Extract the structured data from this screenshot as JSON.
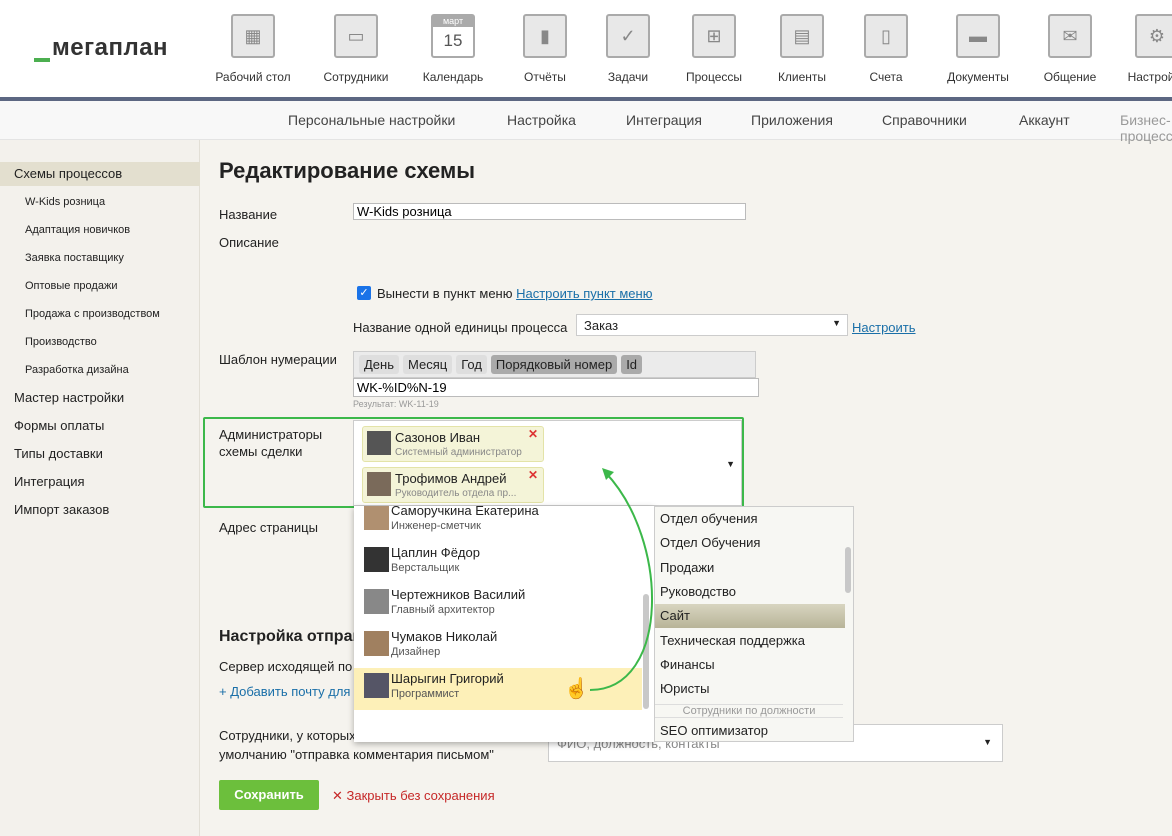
{
  "logo": "мегаплан",
  "nav": [
    {
      "label": "Рабочий стол",
      "icon": "dashboard-icon"
    },
    {
      "label": "Сотрудники",
      "icon": "employees-icon"
    },
    {
      "label": "Календарь",
      "icon": "calendar-icon",
      "badge_month": "март",
      "badge_day": "15"
    },
    {
      "label": "Отчёты",
      "icon": "reports-icon"
    },
    {
      "label": "Задачи",
      "icon": "tasks-icon"
    },
    {
      "label": "Процессы",
      "icon": "processes-icon"
    },
    {
      "label": "Клиенты",
      "icon": "clients-icon"
    },
    {
      "label": "Счета",
      "icon": "invoices-icon"
    },
    {
      "label": "Документы",
      "icon": "documents-icon"
    },
    {
      "label": "Общение",
      "icon": "chat-icon"
    },
    {
      "label": "Настройки",
      "icon": "gear-icon"
    }
  ],
  "subnav": [
    "Персональные настройки",
    "Настройка",
    "Интеграция",
    "Приложения",
    "Справочники",
    "Аккаунт",
    "Бизнес-процессы"
  ],
  "sidebar": [
    {
      "label": "Схемы процессов",
      "level": 0,
      "active": true
    },
    {
      "label": "W-Kids розница",
      "level": 1
    },
    {
      "label": "Адаптация новичков",
      "level": 1
    },
    {
      "label": "Заявка поставщику",
      "level": 1
    },
    {
      "label": "Оптовые продажи",
      "level": 1
    },
    {
      "label": "Продажа с производством",
      "level": 1
    },
    {
      "label": "Производство",
      "level": 1
    },
    {
      "label": "Разработка дизайна",
      "level": 1
    },
    {
      "label": "Мастер настройки",
      "level": 0
    },
    {
      "label": "Формы оплаты",
      "level": 0
    },
    {
      "label": "Типы доставки",
      "level": 0
    },
    {
      "label": "Интеграция",
      "level": 0
    },
    {
      "label": "Импорт заказов",
      "level": 0
    }
  ],
  "form": {
    "title": "Редактирование схемы",
    "name_label": "Название",
    "name_value": "W-Kids розница",
    "desc_label": "Описание",
    "desc_value": "",
    "menu_checkbox_label": "Вынести в пункт меню",
    "menu_checked": true,
    "menu_link": "Настроить пункт меню",
    "unit_label": "Название одной единицы процесса",
    "unit_value": "Заказ",
    "unit_link": "Настроить",
    "numbering_label": "Шаблон нумерации",
    "numbering_tokens": [
      "День",
      "Месяц",
      "Год",
      "Порядковый номер",
      "Id"
    ],
    "numbering_value": "WK-%ID%N-19",
    "numbering_result": "Результат: WK-11-19",
    "admins_label_1": "Администраторы",
    "admins_label_2": "схемы сделки",
    "admins": [
      {
        "name": "Сазонов Иван",
        "position": "Системный администратор"
      },
      {
        "name": "Трофимов Андрей",
        "position": "Руководитель отдела пр..."
      }
    ],
    "address_label": "Адрес страницы",
    "mail_section_title": "Настройка отправки",
    "mail_server_label": "Сервер исходящей по",
    "add_mail_link": "+ Добавить почту для",
    "employees_label_1": "Сотрудники, у которых",
    "employees_label_2": "умолчанию \"отправка комментария письмом\"",
    "employees_placeholder": "ФИО, должность, контакты",
    "save": "Сохранить",
    "close": "Закрыть без сохранения"
  },
  "dropdown": {
    "people": [
      {
        "name": "Саморучкина Екатерина",
        "position": "Инженер-сметчик"
      },
      {
        "name": "Цаплин Фёдор",
        "position": "Верстальщик"
      },
      {
        "name": "Чертежников Василий",
        "position": "Главный архитектор"
      },
      {
        "name": "Чумаков Николай",
        "position": "Дизайнер"
      },
      {
        "name": "Шарыгин Григорий",
        "position": "Программист",
        "hovered": true
      }
    ],
    "departments": [
      "Отдел обучения",
      "Отдел Обучения",
      "Продажи",
      "Руководство",
      "Сайт",
      "Техническая поддержка",
      "Финансы",
      "Юристы"
    ],
    "selected_department": "Сайт",
    "group_header": "Сотрудники по должности",
    "positions": [
      "SEO оптимизатор"
    ]
  },
  "colors": {
    "accent": "#1a6fa8",
    "save": "#6cbf3c",
    "highlight": "#4caf50",
    "hover": "#fdf0b8"
  }
}
